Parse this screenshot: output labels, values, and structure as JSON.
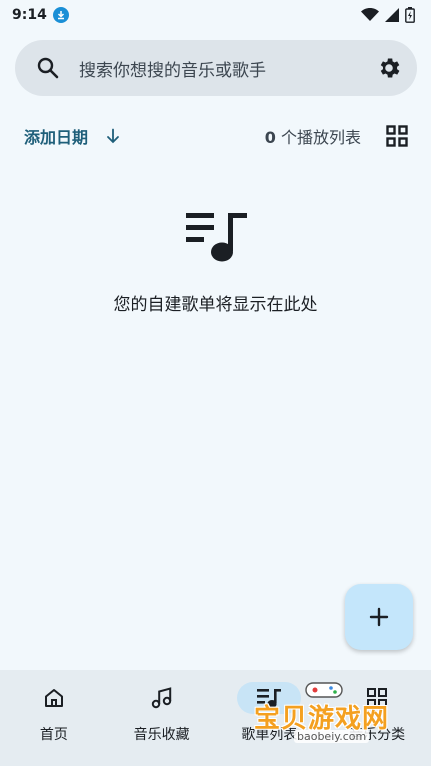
{
  "status": {
    "time": "9:14"
  },
  "search": {
    "placeholder": "搜索你想搜的音乐或歌手"
  },
  "sort": {
    "label": "添加日期",
    "count": "0",
    "count_suffix": " 个播放列表"
  },
  "empty": {
    "message": "您的自建歌单将显示在此处"
  },
  "fab": {
    "label": "+"
  },
  "nav": {
    "items": [
      {
        "label": "首页",
        "icon": "home-icon"
      },
      {
        "label": "音乐收藏",
        "icon": "music-note-icon"
      },
      {
        "label": "歌单列表",
        "icon": "playlist-icon",
        "active": true
      },
      {
        "label": "音乐分类",
        "icon": "category-grid-icon"
      }
    ]
  },
  "watermark": {
    "text": "宝贝游戏网",
    "domain": "baobeiy.com"
  },
  "colors": {
    "background": "#f2f8fc",
    "accent": "#1f5f7a",
    "fab": "#c4e6fb",
    "nav_active": "#c8e4f6"
  }
}
